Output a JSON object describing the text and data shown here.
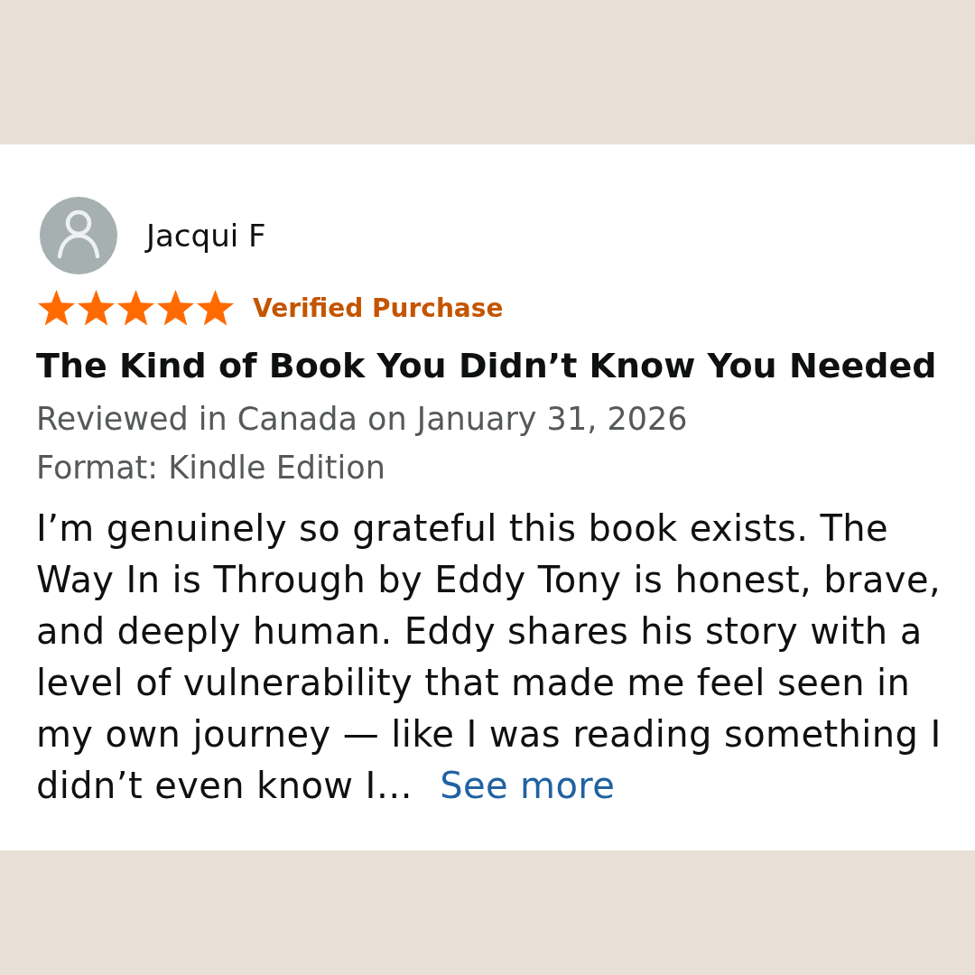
{
  "review": {
    "reviewer": {
      "name": "Jacqui F"
    },
    "stars": 5,
    "badge": "Verified Purchase",
    "title": "The Kind of Book You Didn’t Know You Needed",
    "date_line": "Reviewed in Canada on January 31, 2026",
    "format": "Format: Kindle Edition",
    "body": "I’m genuinely so grateful this book exists. The Way In is Through by Eddy Tony is honest, brave, and deeply human. Eddy shares his story with a level of vulnerability that made me feel seen in my own journey — like I was reading something I didn’t even know I…",
    "see_more": "See more"
  }
}
